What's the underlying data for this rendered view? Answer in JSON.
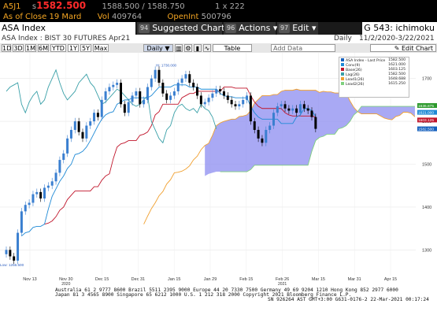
{
  "quote": {
    "ticker": "A5J1",
    "price_prefix": "s",
    "price": "1582.500",
    "bid_ask": "1588.500 / 1588.750",
    "size": "1 x 222",
    "close_label": "As of Close 19 Mard",
    "vol_label": "Vol",
    "vol": "409764",
    "oi_label": "OpenInt",
    "oi": "500796"
  },
  "toolbar": {
    "title": "ASA Index",
    "suggested_num": "94",
    "suggested_label": "Suggested Charts",
    "actions_num": "96",
    "actions_label": "Actions ▾",
    "edit_num": "97",
    "edit_label": "Edit ▾",
    "right_label": "G 543: ichimoku"
  },
  "info": {
    "security": "ASA Index : BIST 30 FUTURES   Apr21",
    "period": "Daily",
    "range": "11/2/2020-3/22/2021"
  },
  "periods": [
    "1D",
    "3D",
    "1M",
    "6M",
    "YTD",
    "1Y",
    "5Y",
    "Max"
  ],
  "period_select": "Daily ▼",
  "table_label": "Table",
  "add_data_label": "Add Data",
  "edit_chart_label": "Edit Chart",
  "colors": {
    "conv": "#1f8ad6",
    "base": "#c0142a",
    "lag": "#3aa0a8",
    "lead1": "#f0a030",
    "lead2": "#7fd07f",
    "cloud": "#8c8cf0",
    "price": "#1560bd"
  },
  "legend": [
    {
      "label": "ASA Index - Last Price",
      "value": "1582.500",
      "color": "#1560bd"
    },
    {
      "label": "Conv(9)",
      "value": "1621.000",
      "color": "#1f8ad6"
    },
    {
      "label": "Base(26)",
      "value": "1603.125",
      "color": "#c0142a"
    },
    {
      "label": "Lag(26)",
      "value": "1582.500",
      "color": "#3aa0a8"
    },
    {
      "label": "Lead1(26)",
      "value": "1648.688",
      "color": "#f0a030"
    },
    {
      "label": "Lead2(26)",
      "value": "1615.250",
      "color": "#7fd07f"
    }
  ],
  "chart_data": {
    "type": "candlestick",
    "x_ticks": [
      "Nov 13",
      "Nov 30",
      "Dec 15",
      "Dec 31",
      "Jan 15",
      "Jan 29",
      "Feb 15",
      "Feb 26",
      "Mar 15",
      "Mar 31",
      "Apr 15"
    ],
    "x_year_labels": [
      {
        "after": "Nov 30",
        "text": "2020"
      },
      {
        "after": "Feb 26",
        "text": "2021"
      }
    ],
    "y_ticks": [
      "1700",
      "1600",
      "1500",
      "1400",
      "1300"
    ],
    "ylim": [
      1240,
      1760
    ],
    "annotations": {
      "high": "Hi: 1730.000",
      "low": "Low: 1256.500"
    },
    "price_tags": [
      {
        "value": "1636.875",
        "color": "#2d9a2d"
      },
      {
        "value": "1621.000",
        "color": "#1f8ad6"
      },
      {
        "value": "1603.125",
        "color": "#c0142a"
      },
      {
        "value": "1582.500",
        "color": "#1560bd"
      }
    ],
    "closes": [
      1300,
      1285,
      1275,
      1340,
      1390,
      1405,
      1410,
      1430,
      1435,
      1420,
      1445,
      1450,
      1460,
      1480,
      1510,
      1525,
      1560,
      1580,
      1600,
      1575,
      1560,
      1590,
      1600,
      1620,
      1610,
      1650,
      1670,
      1680,
      1685,
      1690,
      1640,
      1620,
      1645,
      1660,
      1670,
      1640,
      1650,
      1680,
      1700,
      1720,
      1690,
      1665,
      1650,
      1660,
      1670,
      1690,
      1700,
      1710,
      1690,
      1680,
      1660,
      1640,
      1645,
      1655,
      1665,
      1675,
      1670,
      1660,
      1650,
      1640,
      1635,
      1640,
      1650,
      1660,
      1600,
      1580,
      1560,
      1550,
      1580,
      1590,
      1620,
      1635,
      1640,
      1630,
      1625,
      1630,
      1620,
      1640,
      1630,
      1625,
      1610,
      1582.5
    ]
  },
  "footer": {
    "line1": "Australia 61 2 9777 8600 Brazil 5511 2395 9000 Europe 44 20 7330 7500 Germany 49 69 9204 1210 Hong Kong 852 2977 6000",
    "line2": "Japan 81 3 4565 8900       Singapore 65 6212 1000       U.S. 1 212 318 2000         Copyright 2021 Bloomberg Finance L.P.",
    "line3": "SN 926264 AST  GMT+3:00 G631-0176-2 22-Mar-2021 00:17:24"
  }
}
